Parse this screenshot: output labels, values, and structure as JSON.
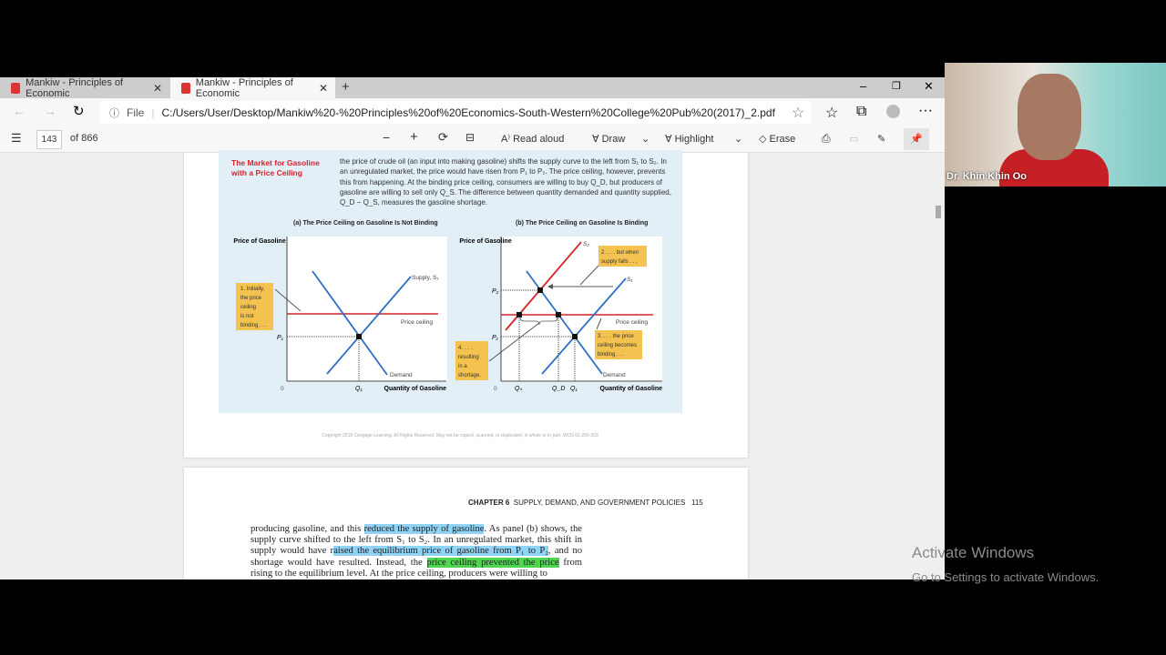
{
  "browser": {
    "tabs": [
      {
        "title": "Mankiw - Principles of Economic"
      },
      {
        "title": "Mankiw - Principles of Economic"
      }
    ],
    "file_label": "File",
    "url": "C:/Users/User/Desktop/Mankiw%20-%20Principles%20of%20Economics-South-Western%20College%20Pub%20(2017)_2.pdf"
  },
  "pdf_toolbar": {
    "page": "143",
    "of": "of 866",
    "read_aloud": "Read aloud",
    "draw": "Draw",
    "highlight": "Highlight",
    "erase": "Erase"
  },
  "figure": {
    "title": "The Market for Gasoline with a Price Ceiling",
    "caption": "the price of crude oil (an input into making gasoline) shifts the supply curve to the left from S₁ to S₂. In an unregulated market, the price would have risen from P₁ to P₂. The price ceiling, however, prevents this from happening. At the binding price ceiling, consumers are willing to buy Q_D, but producers of gasoline are willing to sell only Q_S. The difference between quantity demanded and quantity supplied, Q_D − Q_S, measures the gasoline shortage.",
    "panel_a": {
      "title": "(a) The Price Ceiling on Gasoline Is Not Binding",
      "ylabel": "Price of Gasoline",
      "xlabel": "Quantity of Gasoline",
      "zero": "0",
      "q1": "Q₁",
      "p1": "P₁",
      "supply": "Supply, S₁",
      "demand": "Demand",
      "ceiling": "Price ceiling",
      "note1": [
        "1. Initially,",
        "the price",
        "ceiling",
        "is not",
        "binding . . ."
      ]
    },
    "panel_b": {
      "title": "(b) The Price Ceiling on Gasoline Is Binding",
      "ylabel": "Price of Gasoline",
      "xlabel": "Quantity of Gasoline",
      "zero": "0",
      "qs": "Qₛ",
      "qd": "Q_D",
      "q1": "Q₁",
      "p1": "P₁",
      "p2": "P₂",
      "s1": "S₁",
      "s2": "S₂",
      "demand": "Demand",
      "ceiling": "Price ceiling",
      "note2": [
        "2. . . . but when",
        "supply falls . . ."
      ],
      "note3": [
        "3. . . . the price",
        "ceiling becomes",
        "binding . . ."
      ],
      "note4": [
        "4. . . .",
        "resulting",
        "in a",
        "shortage."
      ]
    },
    "copyright": "Copyright 2018 Cengage Learning. All Rights Reserved. May not be copied, scanned, or duplicated, in whole or in part. WCN 02-200-203"
  },
  "next_page": {
    "chapter": "CHAPTER 6",
    "chapter_title": "SUPPLY, DEMAND, AND GOVERNMENT POLICIES",
    "page_number": "115",
    "t1": "producing gasoline, and this ",
    "h1": "reduced the supply of gasoline",
    "t2": ". As panel (b) shows, the supply curve shifted to the left from S₁ to S₂. In an unregulated market, this shift in supply would have r",
    "h2": "aised the equilibrium price of gasoline from P₁ to P₂",
    "t3": ", and no shortage would have resulted. Instead, the ",
    "h3": "price ceiling prevented the price",
    "t4": " from rising to the equilibrium level. At the price ceiling, producers were willing to"
  },
  "webcam": {
    "name": "Dr. Khin Khin Oo"
  },
  "watermark": {
    "title": "Activate Windows",
    "subtitle": "Go to Settings to activate Windows."
  },
  "colors": {
    "supply_demand": "#2f6fc4",
    "ceiling_s2": "#d4242b",
    "note_box": "#f3c24f"
  }
}
